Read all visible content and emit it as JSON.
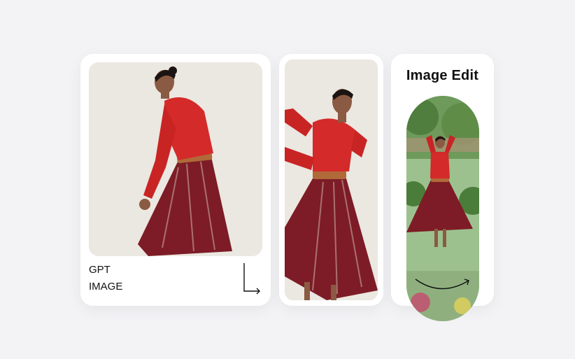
{
  "cards": [
    {
      "caption_line1": "GPT",
      "caption_line2": "IMAGE"
    },
    {},
    {
      "title": "Image Edit"
    }
  ],
  "icons": {
    "corner_arrow": "corner-down-right-arrow-icon",
    "curve_arrow": "curved-arrow-icon"
  },
  "colors": {
    "sweater": "#d42a2a",
    "skirt": "#7d1c26",
    "belt": "#b06a3a",
    "background": "#f3f3f6"
  }
}
